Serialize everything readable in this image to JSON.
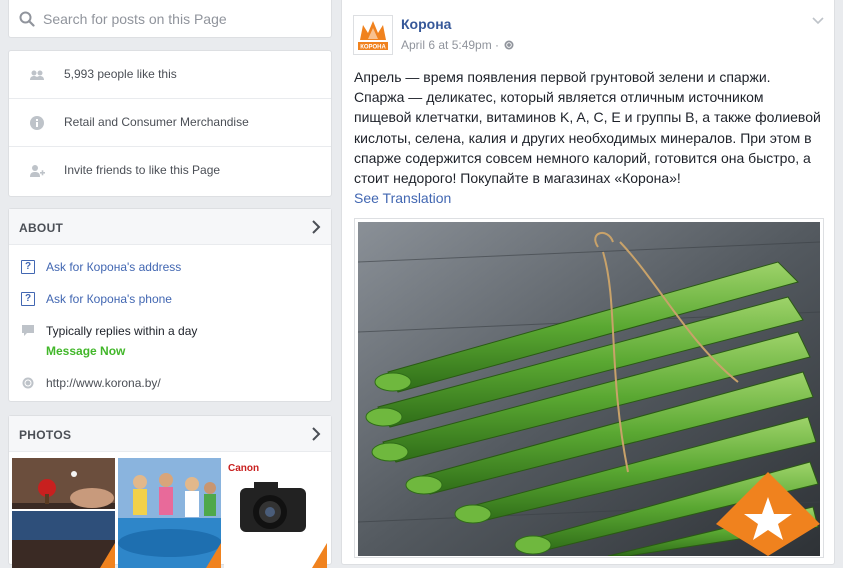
{
  "search": {
    "placeholder": "Search for posts on this Page"
  },
  "stats": {
    "likes": "5,993 people like this",
    "category": "Retail and Consumer Merchandise",
    "invite": "Invite friends to like this Page"
  },
  "about": {
    "title": "ABOUT",
    "address": "Ask for Корона's address",
    "phone": "Ask for Корона's phone",
    "replies": "Typically replies within a day",
    "message": "Message Now",
    "website": "http://www.korona.by/"
  },
  "photos": {
    "title": "PHOTOS",
    "thumb3_brand": "Canon"
  },
  "post": {
    "page_name": "Корона",
    "logo_text": "КОРОНА",
    "timestamp": "April 6 at 5:49pm ·",
    "body": "Апрель — время появления первой грунтовой зелени и спаржи. Спаржа — деликатес, который является отличным источником пищевой клетчатки, витаминов K, A, C, E и группы B, а также фолиевой кислоты, селена, калия и других необходимых минералов. При этом в спарже содержится совсем немного калорий, готовится она быстро, а стоит недорого! Покупайте в магазинах «Корона»!",
    "see_translation": "See Translation"
  },
  "colors": {
    "link": "#4267b2",
    "accent_orange": "#f0821e",
    "green": "#42b72a"
  },
  "icons": [
    "search-icon",
    "people-icon",
    "info-icon",
    "invite-icon",
    "chevron-right-icon",
    "question-icon",
    "chat-icon",
    "globe-icon",
    "chevron-down-icon"
  ]
}
